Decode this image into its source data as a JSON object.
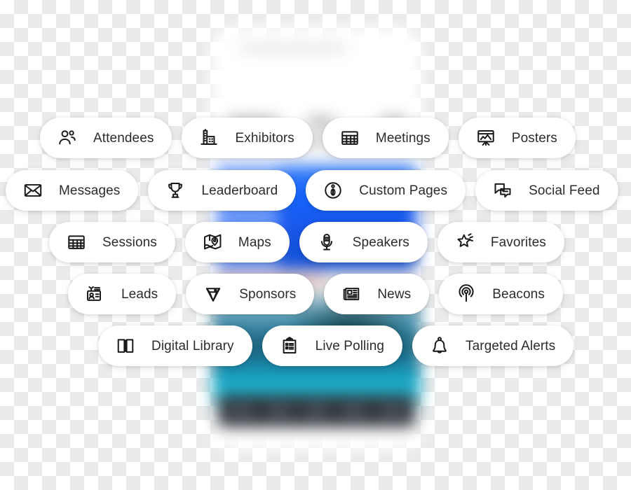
{
  "background": {
    "type": "blurred-phone-screenshot",
    "accent_blue": "#1565ff",
    "accent_teal": "#18b7d3",
    "navbar_color": "#2b2f36",
    "canvas_checker_light": "#ffffff",
    "canvas_checker_dark": "#ebebeb"
  },
  "pill_text_color": "#2a2c30",
  "pill_background": "#ffffff",
  "rows": [
    {
      "id": "row-1",
      "pills": [
        {
          "label": "Attendees",
          "icon": "attendees-people-icon"
        },
        {
          "label": "Exhibitors",
          "icon": "exhibitors-building-icon"
        },
        {
          "label": "Meetings",
          "icon": "meetings-grid-calendar-icon"
        },
        {
          "label": "Posters",
          "icon": "posters-presentation-board-icon"
        }
      ]
    },
    {
      "id": "row-2",
      "pills": [
        {
          "label": "Messages",
          "icon": "messages-envelope-icon"
        },
        {
          "label": "Leaderboard",
          "icon": "leaderboard-trophy-icon"
        },
        {
          "label": "Custom Pages",
          "icon": "custom-pages-info-circle-icon"
        },
        {
          "label": "Social Feed",
          "icon": "social-feed-chat-bubbles-icon"
        }
      ]
    },
    {
      "id": "row-3",
      "pills": [
        {
          "label": "Sessions",
          "icon": "sessions-grid-calendar-icon"
        },
        {
          "label": "Maps",
          "icon": "maps-folded-map-pin-icon"
        },
        {
          "label": "Speakers",
          "icon": "speakers-microphone-icon"
        },
        {
          "label": "Favorites",
          "icon": "favorites-shooting-star-icon"
        }
      ]
    },
    {
      "id": "row-4",
      "pills": [
        {
          "label": "Leads",
          "icon": "leads-badge-scan-icon"
        },
        {
          "label": "Sponsors",
          "icon": "sponsors-diamond-icon"
        },
        {
          "label": "News",
          "icon": "news-newspaper-icon"
        },
        {
          "label": "Beacons",
          "icon": "beacons-signal-icon"
        }
      ]
    },
    {
      "id": "row-5",
      "pills": [
        {
          "label": "Digital Library",
          "icon": "digital-library-open-book-icon"
        },
        {
          "label": "Live Polling",
          "icon": "live-polling-clipboard-icon"
        },
        {
          "label": "Targeted Alerts",
          "icon": "targeted-alerts-bell-icon"
        }
      ]
    }
  ]
}
